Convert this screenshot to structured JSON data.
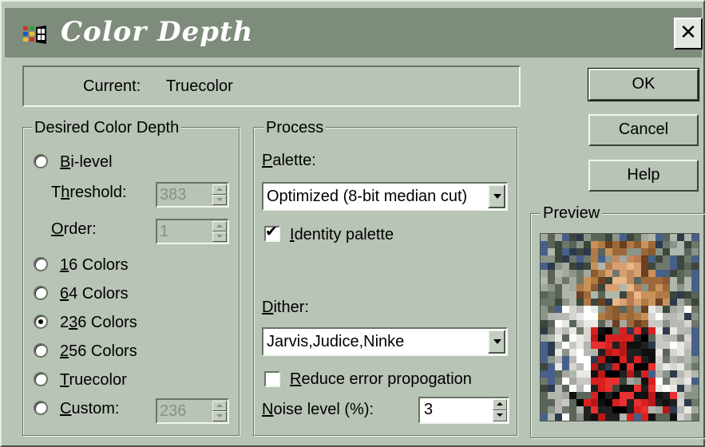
{
  "dialog": {
    "title": "Color Depth",
    "close_glyph": "✕",
    "icon": "windows-flag-icon"
  },
  "current": {
    "label": "Current:",
    "value": "Truecolor"
  },
  "desired": {
    "title": "Desired Color Depth",
    "options": [
      {
        "label": "Bi-level",
        "mnemonic": "B",
        "selected": false
      },
      {
        "label": "16 Colors",
        "mnemonic": "1",
        "selected": false
      },
      {
        "label": "64 Colors",
        "mnemonic": "6",
        "selected": false
      },
      {
        "label": "236 Colors",
        "mnemonic": "3",
        "selected": true
      },
      {
        "label": "256 Colors",
        "mnemonic": "2",
        "selected": false
      },
      {
        "label": "Truecolor",
        "mnemonic": "T",
        "selected": false
      },
      {
        "label": "Custom:",
        "mnemonic": "C",
        "selected": false
      }
    ],
    "threshold": {
      "label": "Threshold:",
      "value": "383",
      "enabled": false
    },
    "order": {
      "label": "Order:",
      "value": "1",
      "enabled": false
    },
    "custom_value": "236"
  },
  "process": {
    "title": "Process",
    "palette": {
      "label": "Palette:",
      "value": "Optimized (8-bit median cut)"
    },
    "identity_palette": {
      "label": "Identity palette",
      "checked": true
    },
    "dither": {
      "label": "Dither:",
      "value": "Jarvis,Judice,Ninke"
    },
    "reduce_error": {
      "label": "Reduce error propogation",
      "checked": false
    },
    "noise": {
      "label": "Noise level (%):",
      "value": "3"
    }
  },
  "buttons": {
    "ok": "OK",
    "cancel": "Cancel",
    "help": "Help"
  },
  "preview": {
    "title": "Preview",
    "image": "dithered-photo-preview"
  },
  "colors": {
    "face": "#b8c4b6",
    "titlebar": "#7e8c7b",
    "title_text": "#ffffff",
    "disabled_text": "#86908a"
  }
}
